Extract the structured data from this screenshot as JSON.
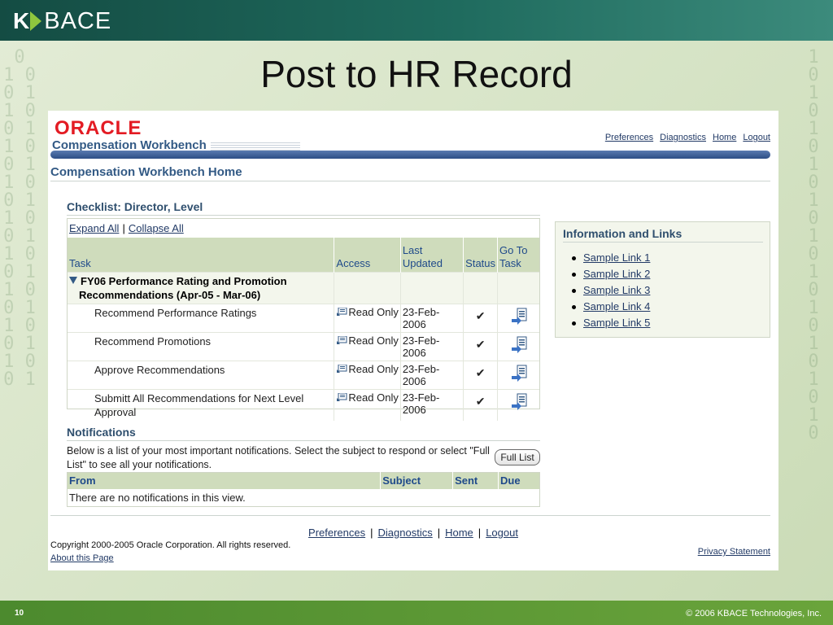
{
  "slide": {
    "logo_text": "BACE",
    "logo_k": "K",
    "title": "Post to HR Record",
    "page_number": "10",
    "copyright": "© 2006 KBACE Technologies, Inc."
  },
  "app": {
    "vendor_logo": "ORACLE",
    "name": "Compensation Workbench",
    "global_links": [
      "Preferences",
      "Diagnostics",
      "Home",
      "Logout"
    ],
    "page_heading": "Compensation Workbench Home"
  },
  "checklist": {
    "title": "Checklist: Director, Level",
    "expand_all": "Expand All",
    "collapse_all": "Collapse All",
    "columns": {
      "task": "Task",
      "access": "Access",
      "last_updated_1": "Last",
      "last_updated_2": "Updated",
      "status": "Status",
      "goto_1": "Go To",
      "goto_2": "Task"
    },
    "group_label": "FY06 Performance Rating and Promotion Recommendations (Apr-05 - Mar-06)",
    "rows": [
      {
        "task": "Recommend Performance Ratings",
        "access": "Read Only",
        "updated": "23-Feb-2006"
      },
      {
        "task": "Recommend Promotions",
        "access": "Read Only",
        "updated": "23-Feb-2006"
      },
      {
        "task": "Approve Recommendations",
        "access": "Read Only",
        "updated": "23-Feb-2006"
      },
      {
        "task": "Submitt All Recommendations for Next Level Approval",
        "access": "Read Only",
        "updated": "23-Feb-2006"
      }
    ],
    "status_icon": "checkmark-icon",
    "goto_icon": "goto-task-icon",
    "access_icon": "read-only-icon"
  },
  "info": {
    "title": "Information and Links",
    "links": [
      "Sample Link 1",
      "Sample Link 2",
      "Sample Link 3",
      "Sample Link 4",
      "Sample Link 5"
    ]
  },
  "notifications": {
    "title": "Notifications",
    "description": "Below is a list of your most important notifications. Select the subject to respond or select \"Full List\" to see all your notifications.",
    "full_list_button": "Full List",
    "columns": {
      "from": "From",
      "subject": "Subject",
      "sent": "Sent",
      "due": "Due"
    },
    "empty_text": "There are no notifications in this view."
  },
  "footer": {
    "links": [
      "Preferences",
      "Diagnostics",
      "Home",
      "Logout"
    ],
    "copyright": "Copyright 2000-2005 Oracle Corporation. All rights reserved.",
    "about": "About this Page",
    "privacy": "Privacy Statement"
  },
  "colors": {
    "header_teal": "#1f6b5e",
    "footer_green": "#6aa43b",
    "oracle_red": "#e31b23",
    "brand_blue": "#2d4e86",
    "table_header": "#cfdcbc"
  }
}
